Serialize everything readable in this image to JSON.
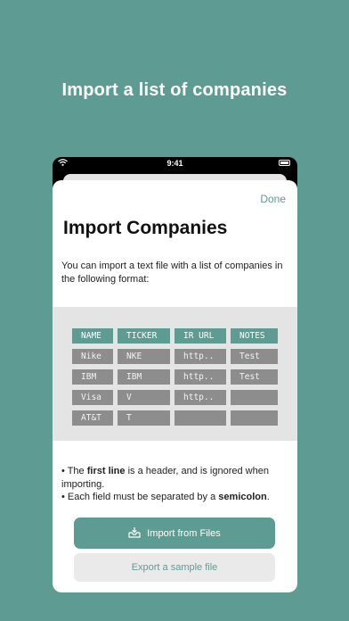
{
  "headline": "Import a list of companies",
  "status_bar": {
    "time": "9:41"
  },
  "sheet": {
    "done_label": "Done",
    "title": "Import Companies",
    "intro": "You can import a text file with a list of companies in the following format:"
  },
  "table": {
    "headers": [
      "NAME",
      "TICKER",
      "IR URL",
      "NOTES"
    ],
    "rows": [
      [
        "Nike",
        "NKE",
        "http..",
        "Test"
      ],
      [
        "IBM",
        "IBM",
        "http..",
        "Test"
      ],
      [
        "Visa",
        "V",
        "http..",
        ""
      ],
      [
        "AT&T",
        "T",
        "",
        ""
      ]
    ]
  },
  "notes": {
    "line1_prefix": "• The ",
    "line1_bold": "first line",
    "line1_suffix": " is a header, and is ignored when importing.",
    "line2_prefix": "• Each field must be separated by a ",
    "line2_bold": "semicolon",
    "line2_suffix": "."
  },
  "buttons": {
    "import_label": "Import from Files",
    "import_icon": "tray-import-icon",
    "export_label": "Export a sample file"
  },
  "colors": {
    "accent": "#5e9c93",
    "cell": "#8d8d8d",
    "table_bg": "#e4e4e4"
  }
}
